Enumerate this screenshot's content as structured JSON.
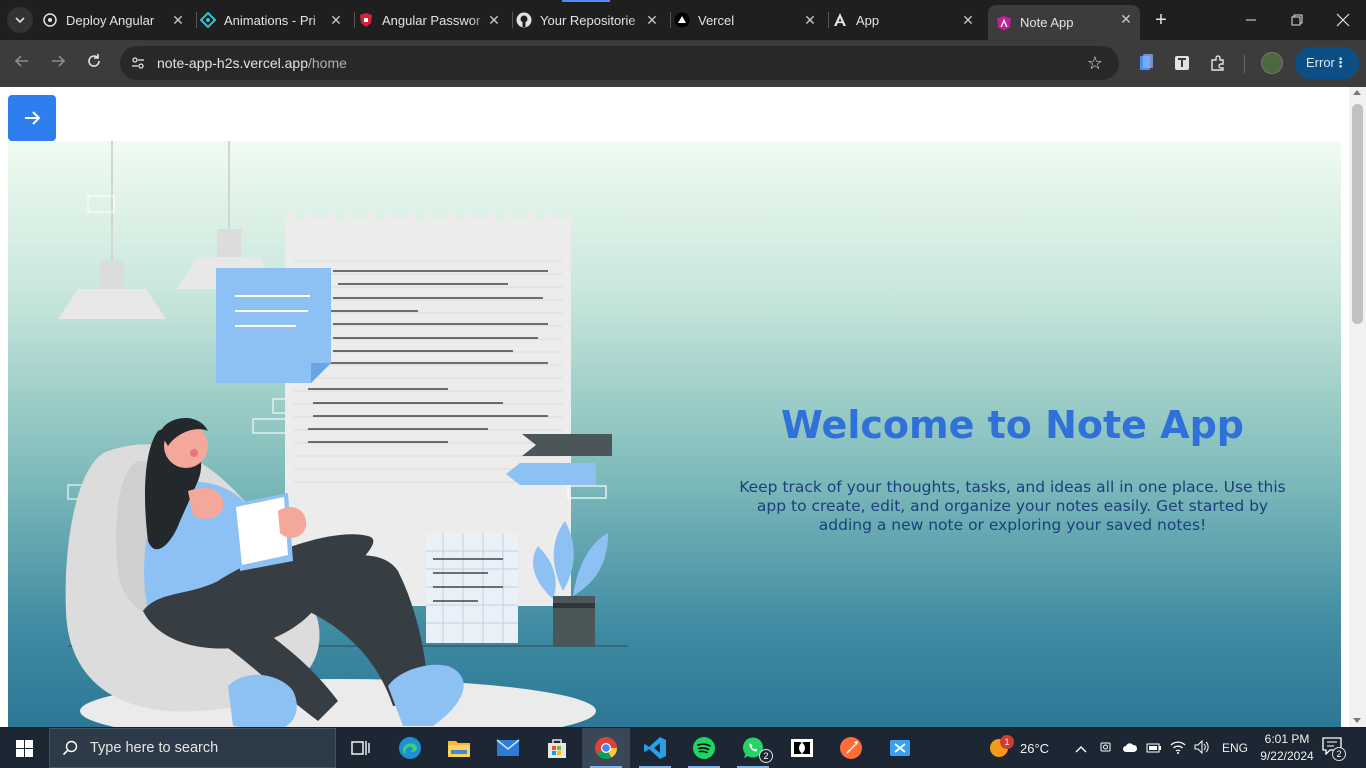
{
  "browser": {
    "tabs": [
      {
        "title": "Deploy Angular",
        "icon": "openai-icon",
        "active": false
      },
      {
        "title": "Animations - Pri",
        "icon": "primeng-icon",
        "active": false
      },
      {
        "title": "Angular Passwor",
        "icon": "brave-shield-icon",
        "active": false
      },
      {
        "title": "Your Repositorie",
        "icon": "github-icon",
        "active": false
      },
      {
        "title": "Vercel",
        "icon": "vercel-icon",
        "active": false
      },
      {
        "title": "App",
        "icon": "angular-icon",
        "active": false
      },
      {
        "title": "Note App",
        "icon": "angular-icon",
        "active": true
      }
    ],
    "url_host": "note-app-h2s.vercel.app",
    "url_path": "/home",
    "error_label": "Error"
  },
  "page": {
    "welcome_title": "Welcome to Note App",
    "description": "Keep track of your thoughts, tasks, and ideas all in one place. Use this app to create, edit, and organize your notes easily. Get started by adding a new note or exploring your saved notes!",
    "accent_color": "#2f71d8",
    "button_color": "#2f7ef0"
  },
  "taskbar": {
    "search_placeholder": "Type here to search",
    "weather_temp": "26°C",
    "language": "ENG",
    "time": "6:01 PM",
    "date": "9/22/2024",
    "whatsapp_badge": "2",
    "notification_count": "2",
    "weather_badge": "1"
  }
}
